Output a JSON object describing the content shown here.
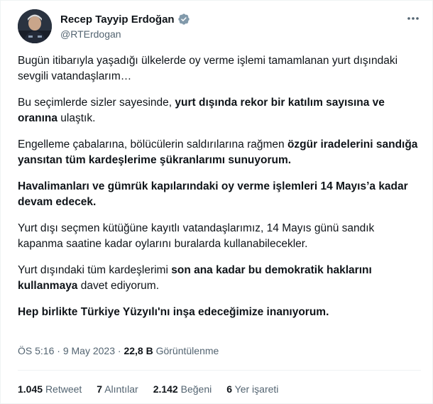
{
  "author": {
    "display_name": "Recep Tayyip Erdoğan",
    "handle": "@RTErdogan",
    "verified_icon": "verified-badge-icon",
    "verified_color": "#829aab"
  },
  "tweet": {
    "paragraphs": [
      [
        {
          "text": "Bugün itibarıyla yaşadığı ülkelerde oy verme işlemi tamamlanan yurt dışındaki sevgili vatandaşlarım…",
          "bold": false
        }
      ],
      [
        {
          "text": "Bu seçimlerde sizler sayesinde, ",
          "bold": false
        },
        {
          "text": "yurt dışında rekor bir katılım sayısına ve oranına",
          "bold": true
        },
        {
          "text": " ulaştık.",
          "bold": false
        }
      ],
      [
        {
          "text": "Engelleme çabalarına, bölücülerin saldırılarına rağmen ",
          "bold": false
        },
        {
          "text": "özgür iradelerini sandığa yansıtan tüm kardeşlerime şükranlarımı sunuyorum.",
          "bold": true
        }
      ],
      [
        {
          "text": "Havalimanları ve gümrük kapılarındaki oy verme işlemleri 14 Mayıs’a kadar devam edecek.",
          "bold": true
        }
      ],
      [
        {
          "text": "Yurt dışı seçmen kütüğüne kayıtlı vatandaşlarımız, 14 Mayıs günü sandık kapanma saatine kadar oylarını buralarda kullanabilecekler.",
          "bold": false
        }
      ],
      [
        {
          "text": "Yurt dışındaki tüm kardeşlerimi ",
          "bold": false
        },
        {
          "text": "son ana kadar bu demokratik haklarını kullanmaya",
          "bold": true
        },
        {
          "text": " davet ediyorum.",
          "bold": false
        }
      ],
      [
        {
          "text": "Hep birlikte Türkiye Yüzyılı'nı inşa edeceğimize inanıyorum.",
          "bold": true
        }
      ]
    ]
  },
  "meta": {
    "time": "ÖS 5:16",
    "separator": " · ",
    "date": "9 May 2023",
    "views_count": "22,8 B",
    "views_label": " Görüntülenme"
  },
  "stats": [
    {
      "num": "1.045",
      "label": "Retweet"
    },
    {
      "num": "7",
      "label": "Alıntılar"
    },
    {
      "num": "2.142",
      "label": "Beğeni"
    },
    {
      "num": "6",
      "label": "Yer işareti"
    }
  ],
  "icons": {
    "more": "more-options-icon",
    "avatar": "avatar"
  }
}
